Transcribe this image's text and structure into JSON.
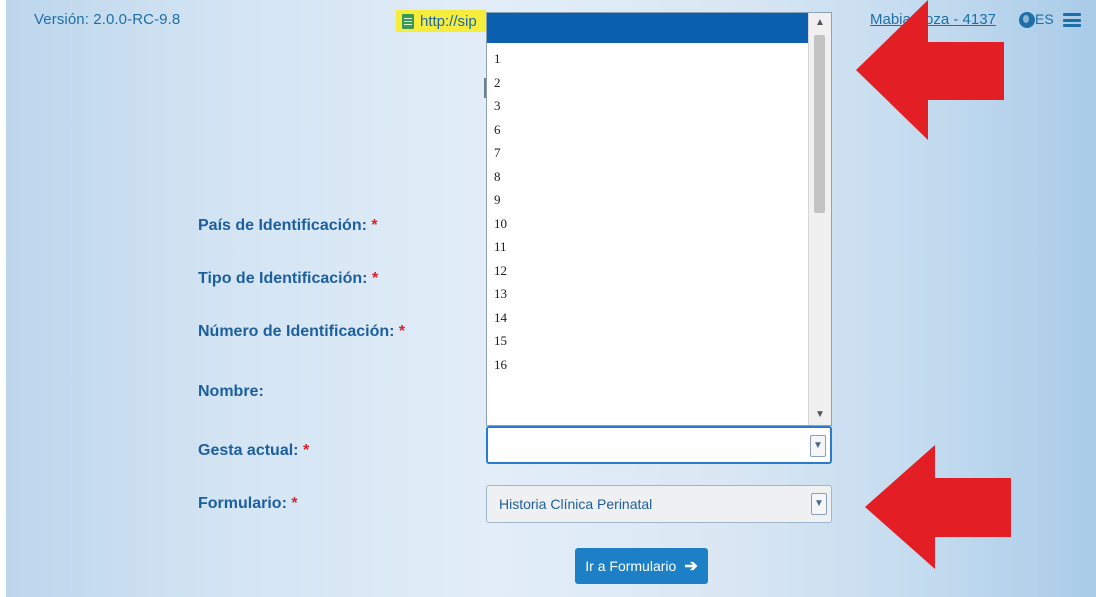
{
  "header": {
    "version": "Versión: 2.0.0-RC-9.8",
    "url_text": "http://sip",
    "user": "Mabia Soza - 4137",
    "lang": "ES"
  },
  "dropdown": {
    "items": [
      "1",
      "2",
      "3",
      "6",
      "7",
      "8",
      "9",
      "10",
      "11",
      "12",
      "13",
      "14",
      "15",
      "16"
    ]
  },
  "form": {
    "labels": {
      "pais": "País de Identificación:",
      "tipo": "Tipo de Identificación:",
      "numero": "Número de Identificación:",
      "nombre": "Nombre:",
      "gesta": "Gesta actual:",
      "formulario": "Formulario:"
    },
    "required_mark": "*",
    "gesta_value": "",
    "formulario_value": "Historia Clínica Perinatal",
    "button_label": "Ir a Formulario"
  },
  "icons": {
    "url": "document-icon",
    "lang": "globe-icon",
    "menu": "hamburger-menu-icon",
    "annotation": "red-arrow-annotation",
    "button": "arrow-right-icon"
  },
  "colors": {
    "primary": "#1e6fa8",
    "required": "#d8222a",
    "selected": "#0a5fae",
    "annotation": "#e31e24",
    "highlight": "#f5ec3c"
  }
}
